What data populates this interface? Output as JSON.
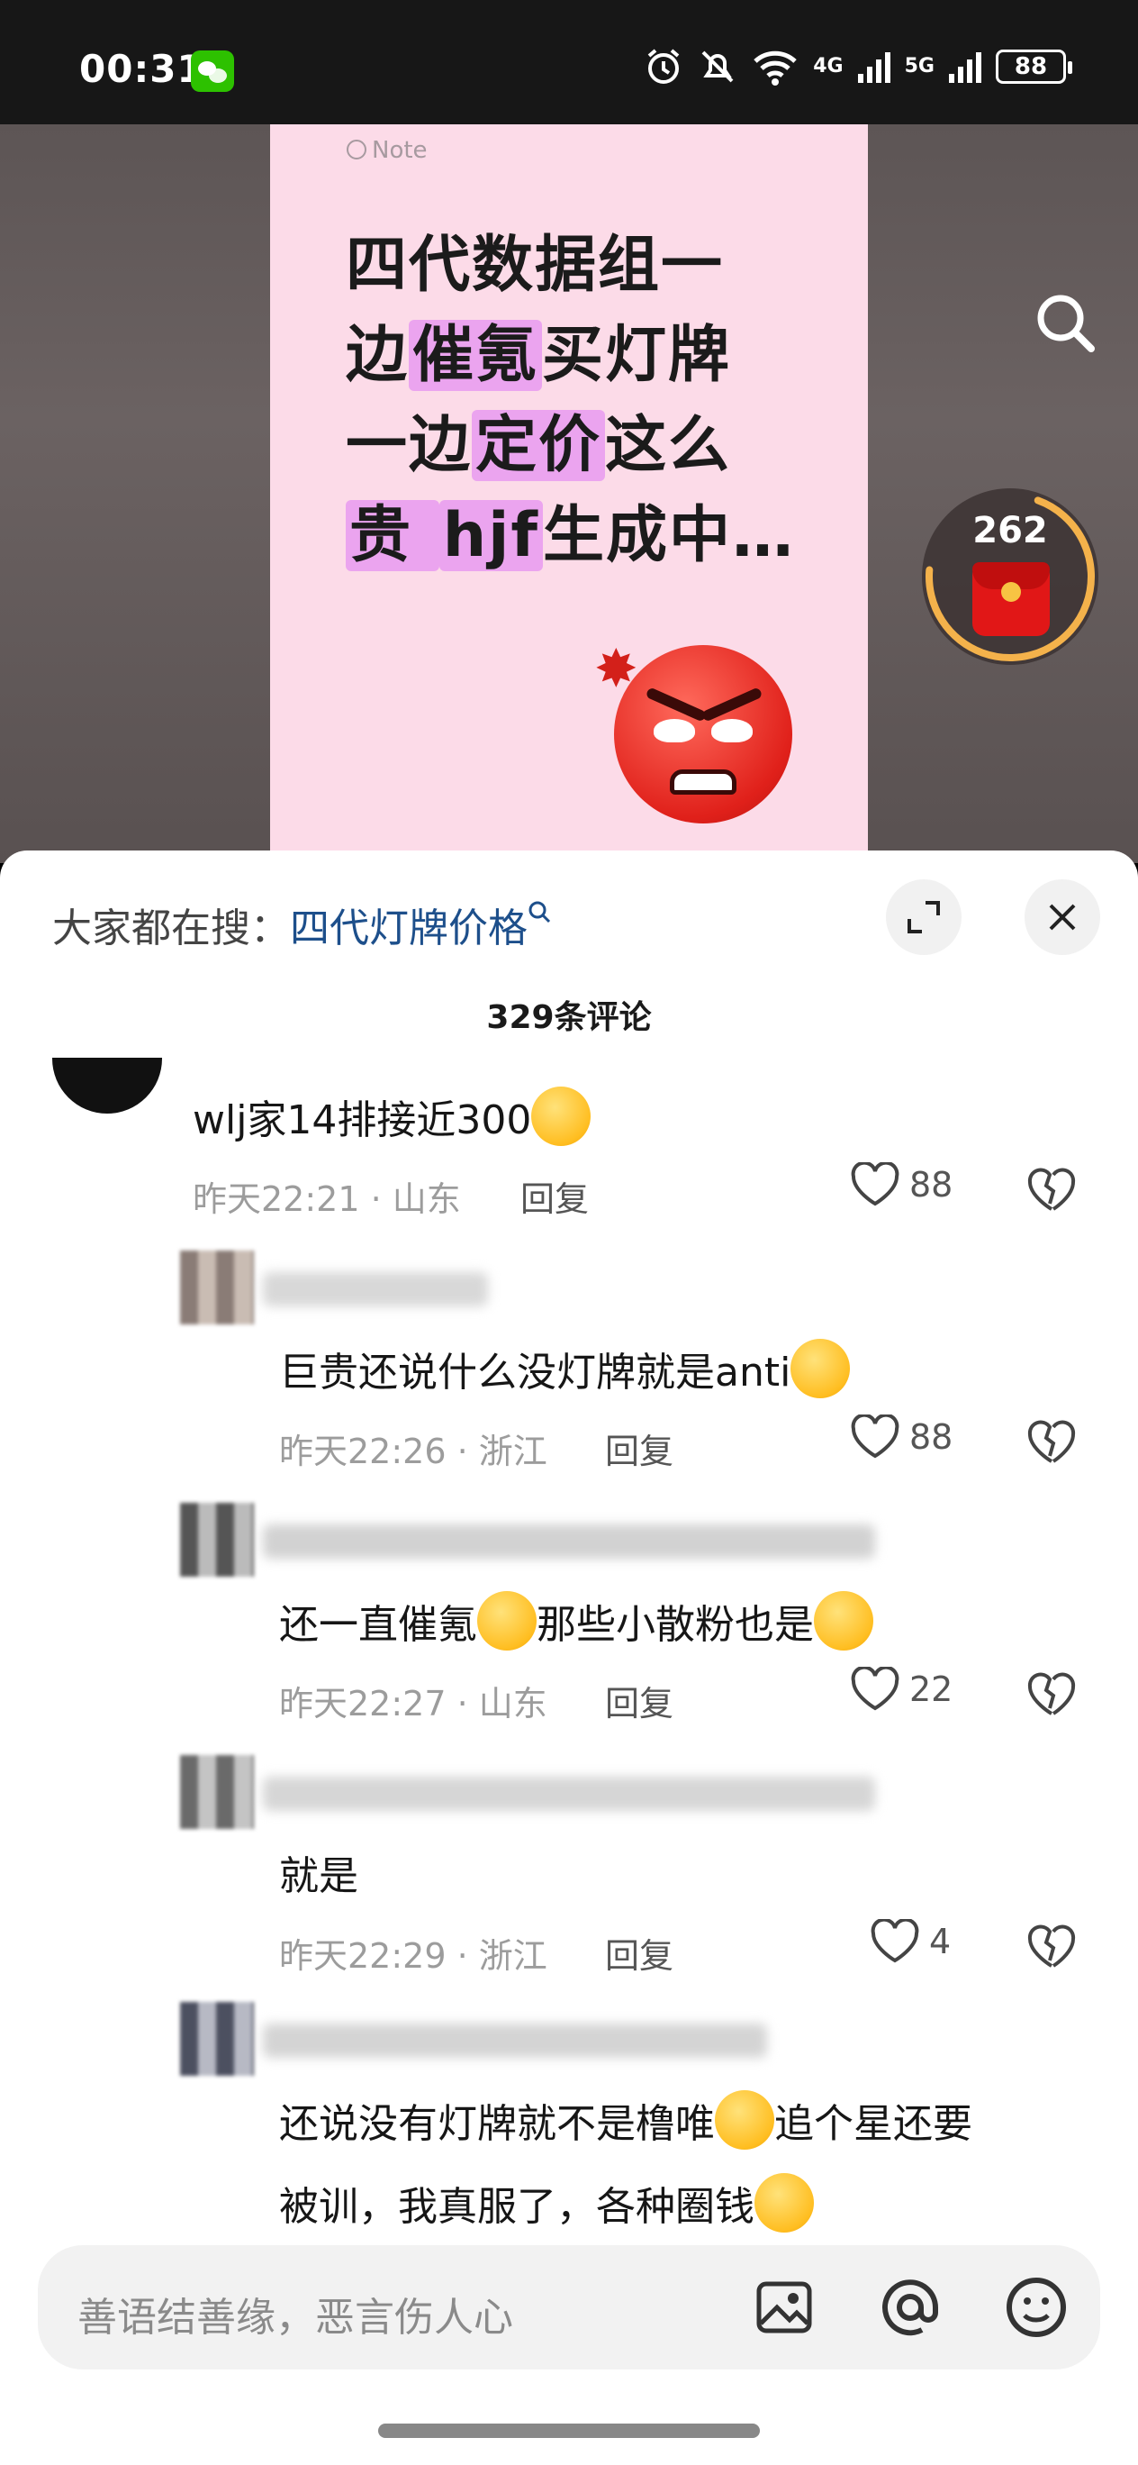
{
  "status_bar": {
    "time": "00:31",
    "network_4g": "4G",
    "network_5g": "5G",
    "battery": "88"
  },
  "video": {
    "note_label": "Note",
    "lines": [
      [
        "四代数据组一",
        "",
        ""
      ],
      [
        "边",
        "催氪",
        "买灯牌"
      ],
      [
        "一边",
        "定价",
        "这么"
      ],
      [
        "贵  ",
        "hjf",
        "生成中…"
      ]
    ],
    "redpack_count": "262"
  },
  "sheet": {
    "search_prefix": "大家都在搜：",
    "search_keyword": "四代灯牌价格",
    "comment_count": "329条评论",
    "reply_label": "回复",
    "comments": [
      {
        "text": "wlj家14排接近300",
        "time": "昨天22:21 · 山东",
        "likes": "88"
      },
      {
        "text": "巨贵还说什么没灯牌就是anti",
        "time": "昨天22:26 · 浙江",
        "likes": "88"
      },
      {
        "text_a": "还一直催氪",
        "text_b": "那些小散粉也是",
        "time": "昨天22:27 · 山东",
        "likes": "22"
      },
      {
        "text": "就是",
        "time": "昨天22:29 · 浙江",
        "likes": "4"
      },
      {
        "text_a": "还说没有灯牌就不是橹唯",
        "text_b": "追个星还要",
        "line2": "被训，我真服了，各种圈钱"
      }
    ]
  },
  "input": {
    "placeholder": "善语结善缘，恶言伤人心"
  },
  "colors": {
    "highlight": "#eba4ef",
    "note_bg": "#fcdbe8",
    "keyword": "#1d4f8b"
  }
}
